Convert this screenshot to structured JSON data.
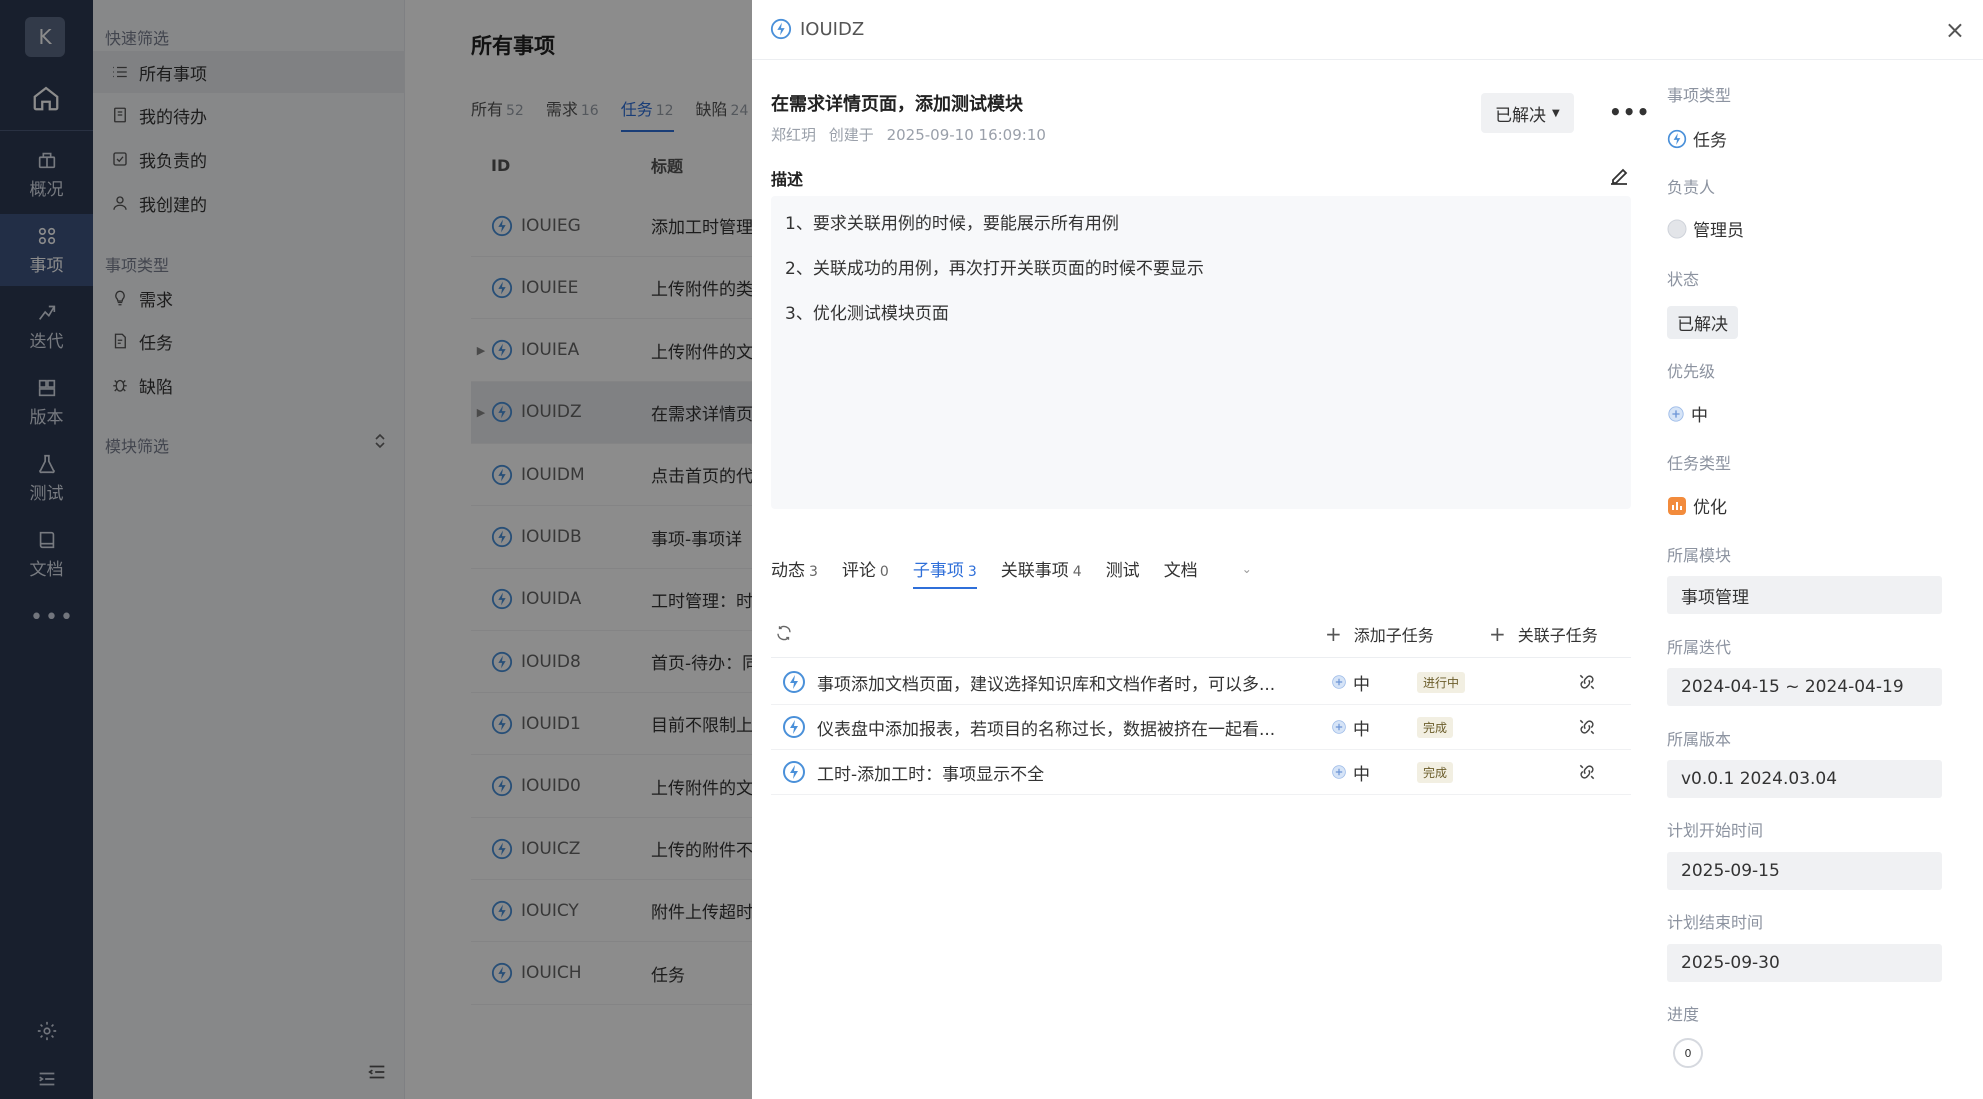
{
  "rail": {
    "avatar": "K",
    "items": [
      {
        "label": "概况"
      },
      {
        "label": "事项"
      },
      {
        "label": "迭代"
      },
      {
        "label": "版本"
      },
      {
        "label": "测试"
      },
      {
        "label": "文档"
      }
    ],
    "more": "•••"
  },
  "filters": {
    "quick_head": "快速筛选",
    "quick": [
      "所有事项",
      "我的待办",
      "我负责的",
      "我创建的"
    ],
    "type_head": "事项类型",
    "types": [
      "需求",
      "任务",
      "缺陷"
    ],
    "module_head": "模块筛选"
  },
  "list": {
    "title": "所有事项",
    "tabs": [
      {
        "label": "所有",
        "count": "52"
      },
      {
        "label": "需求",
        "count": "16"
      },
      {
        "label": "任务",
        "count": "12"
      },
      {
        "label": "缺陷",
        "count": "24"
      }
    ],
    "columns": [
      "ID",
      "标题"
    ],
    "rows": [
      {
        "id": "IOUIEG",
        "title": "添加工时管理"
      },
      {
        "id": "IOUIEE",
        "title": "上传附件的类"
      },
      {
        "id": "IOUIEA",
        "title": "上传附件的文"
      },
      {
        "id": "IOUIDZ",
        "title": "在需求详情页"
      },
      {
        "id": "IOUIDM",
        "title": "点击首页的代"
      },
      {
        "id": "IOUIDB",
        "title": "事项-事项详"
      },
      {
        "id": "IOUIDA",
        "title": "工时管理：时"
      },
      {
        "id": "IOUID8",
        "title": "首页-待办：同"
      },
      {
        "id": "IOUID1",
        "title": "目前不限制上"
      },
      {
        "id": "IOUID0",
        "title": "上传附件的文"
      },
      {
        "id": "IOUICZ",
        "title": "上传的附件不"
      },
      {
        "id": "IOUICY",
        "title": "附件上传超时"
      },
      {
        "id": "IOUICH",
        "title": "任务"
      }
    ]
  },
  "detail": {
    "id": "IOUIDZ",
    "close": "×",
    "title": "在需求详情页面，添加测试模块",
    "author": "郑红玥",
    "created_label": "创建于",
    "created_at": "2025-09-10 16:09:10",
    "status": "已解决",
    "desc_label": "描述",
    "desc_lines": [
      "1、要求关联用例的时候，要能展示所有用例",
      "2、关联成功的用例，再次打开关联页面的时候不要显示",
      "3、优化测试模块页面"
    ],
    "tabs": [
      {
        "label": "动态",
        "count": "3"
      },
      {
        "label": "评论",
        "count": "0"
      },
      {
        "label": "子事项",
        "count": "3"
      },
      {
        "label": "关联事项",
        "count": "4"
      },
      {
        "label": "测试",
        "count": ""
      },
      {
        "label": "文档",
        "count": ""
      }
    ],
    "add_child": "添加子任务",
    "link_child": "关联子任务",
    "children": [
      {
        "title": "事项添加文档页面，建议选择知识库和文档作者时，可以多...",
        "priority": "中",
        "status": "进行中"
      },
      {
        "title": "仪表盘中添加报表，若项目的名称过长，数据被挤在一起看...",
        "priority": "中",
        "status": "完成"
      },
      {
        "title": "工时-添加工时：事项显示不全",
        "priority": "中",
        "status": "完成"
      }
    ]
  },
  "attrs": {
    "type_label": "事项类型",
    "type": "任务",
    "owner_label": "负责人",
    "owner": "管理员",
    "status_label": "状态",
    "status": "已解决",
    "priority_label": "优先级",
    "priority": "中",
    "task_type_label": "任务类型",
    "task_type": "优化",
    "module_label": "所属模块",
    "module": "事项管理",
    "sprint_label": "所属迭代",
    "sprint": "2024-04-15 ~ 2024-04-19",
    "version_label": "所属版本",
    "version": "v0.0.1 2024.03.04",
    "plan_start_label": "计划开始时间",
    "plan_start": "2025-09-15",
    "plan_end_label": "计划结束时间",
    "plan_end": "2025-09-30",
    "progress_label": "进度",
    "progress": "0"
  },
  "colors": {
    "accent": "#2f6fd9",
    "rail": "#2d3a52",
    "task_icon": "#4a90d9",
    "optimize_tag": "#f28b3c"
  }
}
